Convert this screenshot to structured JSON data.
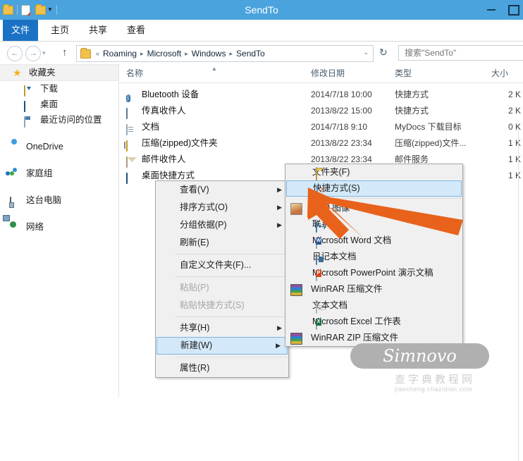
{
  "window": {
    "title": "SendTo",
    "minimize_label": "最小化",
    "restore_label": "向下还原",
    "quick_access": [
      "folder-icon",
      "properties-icon",
      "new-folder-icon",
      "customize-caret-icon"
    ]
  },
  "ribbon": {
    "tabs": [
      {
        "label": "文件",
        "active": true
      },
      {
        "label": "主页",
        "active": false
      },
      {
        "label": "共享",
        "active": false
      },
      {
        "label": "查看",
        "active": false
      }
    ]
  },
  "addressbar": {
    "back_icon": "←",
    "forward_icon": "→",
    "recent_caret": "▾",
    "up_icon": "↑",
    "prefix": "«",
    "crumbs": [
      "Roaming",
      "Microsoft",
      "Windows",
      "SendTo"
    ],
    "separator": "▸",
    "dropdown_caret": "⌄",
    "refresh_icon": "↻",
    "search_placeholder": "搜索\"SendTo\"",
    "search_value": ""
  },
  "navpane": {
    "groups": [
      {
        "label": "收藏夹",
        "icon": "star-icon",
        "children": [
          {
            "label": "下载",
            "icon": "downloads-icon"
          },
          {
            "label": "桌面",
            "icon": "desktop-icon"
          },
          {
            "label": "最近访问的位置",
            "icon": "recent-places-icon"
          }
        ]
      },
      {
        "label": "OneDrive",
        "icon": "onedrive-icon",
        "children": []
      },
      {
        "label": "家庭组",
        "icon": "homegroup-icon",
        "children": []
      },
      {
        "label": "这台电脑",
        "icon": "this-pc-icon",
        "children": []
      },
      {
        "label": "网络",
        "icon": "network-icon",
        "children": []
      }
    ]
  },
  "filelist": {
    "columns": [
      {
        "label": "名称",
        "sorted": true,
        "sort_caret": "▲"
      },
      {
        "label": "修改日期"
      },
      {
        "label": "类型"
      },
      {
        "label": "大小"
      }
    ],
    "rows": [
      {
        "name": "Bluetooth 设备",
        "icon": "bluetooth-icon",
        "date": "2014/7/18 10:00",
        "type": "快捷方式",
        "size": "2 K"
      },
      {
        "name": "传真收件人",
        "icon": "fax-icon",
        "date": "2013/8/22 15:00",
        "type": "快捷方式",
        "size": "2 K"
      },
      {
        "name": "文档",
        "icon": "document-icon",
        "date": "2014/7/18 9:10",
        "type": "MyDocs 下载目标",
        "size": "0 K"
      },
      {
        "name": "压缩(zipped)文件夹",
        "icon": "zip-folder-icon",
        "date": "2013/8/22 23:34",
        "type": "压缩(zipped)文件...",
        "size": "1 K"
      },
      {
        "name": "邮件收件人",
        "icon": "mail-icon",
        "date": "2013/8/22 23:34",
        "type": "邮件服务",
        "size": "1 K"
      },
      {
        "name": "桌面快捷方式",
        "icon": "desktop-shortcut-icon",
        "date": "",
        "type": "",
        "size": "1 K"
      }
    ]
  },
  "context_menu": {
    "items": [
      {
        "label": "查看(V)",
        "submenu": true,
        "arrow": "▶"
      },
      {
        "label": "排序方式(O)",
        "submenu": true,
        "arrow": "▶"
      },
      {
        "label": "分组依据(P)",
        "submenu": true,
        "arrow": "▶"
      },
      {
        "label": "刷新(E)",
        "submenu": false
      },
      {
        "separator": true
      },
      {
        "label": "自定义文件夹(F)...",
        "submenu": false
      },
      {
        "separator": true
      },
      {
        "label": "粘贴(P)",
        "disabled": true
      },
      {
        "label": "粘贴快捷方式(S)",
        "disabled": true
      },
      {
        "separator": true
      },
      {
        "label": "共享(H)",
        "submenu": true,
        "arrow": "▶"
      },
      {
        "label": "新建(W)",
        "submenu": true,
        "arrow": "▶",
        "selected": true
      },
      {
        "separator": true
      },
      {
        "label": "属性(R)",
        "submenu": false
      }
    ]
  },
  "new_submenu": {
    "items": [
      {
        "label": "文件夹(F)",
        "icon": "folder-icon"
      },
      {
        "label": "快捷方式(S)",
        "icon": "shortcut-icon",
        "selected": true
      },
      {
        "separator": true
      },
      {
        "label": "BMP 图像",
        "icon": "bmp-image-icon"
      },
      {
        "label": "联系人",
        "icon": "contact-icon"
      },
      {
        "label": "Microsoft Word 文档",
        "icon": "word-icon"
      },
      {
        "label": "日记本文档",
        "icon": "journal-icon"
      },
      {
        "label": "Microsoft PowerPoint 演示文稿",
        "icon": "powerpoint-icon"
      },
      {
        "label": "WinRAR 压缩文件",
        "icon": "winrar-icon"
      },
      {
        "label": "文本文档",
        "icon": "text-file-icon"
      },
      {
        "label": "Microsoft Excel 工作表",
        "icon": "excel-icon"
      },
      {
        "label": "WinRAR ZIP 压缩文件",
        "icon": "winrar-zip-icon"
      }
    ]
  },
  "annotation": {
    "arrow_color": "#e8621c",
    "arrow_target": "快捷方式(S)"
  },
  "watermark": {
    "brand": "Simnovo",
    "site_cn": "查字典教程网",
    "site_url": "jiaocheng.chazidian.com"
  },
  "colors": {
    "titlebar": "#4aa3dd",
    "file_tab": "#1b72c4",
    "menu_bg": "#f0f0f0",
    "selection": "#d3e9f9",
    "selection_border": "#7eb4e0"
  }
}
